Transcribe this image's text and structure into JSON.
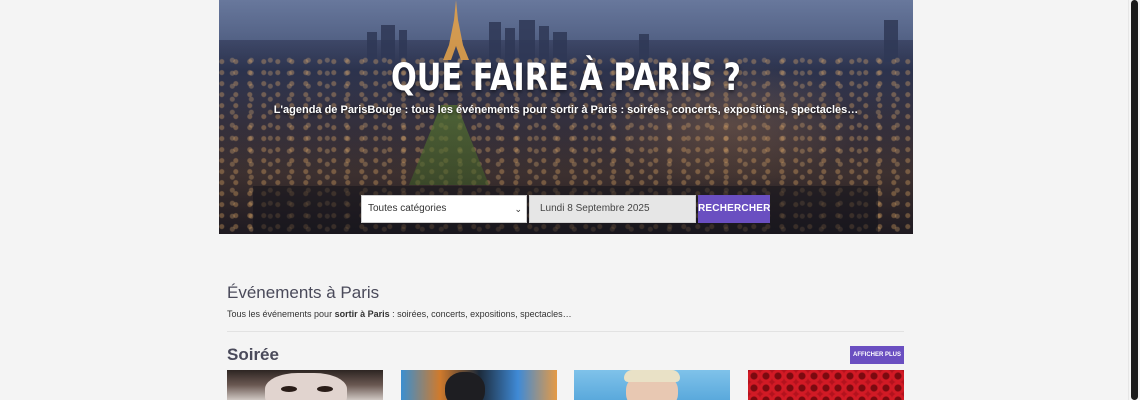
{
  "hero": {
    "title": "QUE FAIRE À PARIS ?",
    "subtitle": "L'agenda de ParisBouge : tous les événements pour sortir à Paris : soirées, concerts, expositions, spectacles…"
  },
  "search": {
    "category_value": "Toutes catégories",
    "date_value": "Lundi 8 Septembre 2025",
    "submit_label": "RECHERCHER"
  },
  "events_section": {
    "title": "Événements à Paris",
    "desc_prefix": "Tous les événements pour ",
    "desc_bold": "sortir à Paris",
    "desc_suffix": " : soirées, concerts, expositions, spectacles…"
  },
  "category": {
    "title": "Soirée",
    "more_label": "AFFICHER PLUS"
  },
  "colors": {
    "accent": "#6a4fc1",
    "page_bg": "#f4f4f4"
  },
  "icons": {
    "select_chevron": "chevron-down-icon"
  }
}
